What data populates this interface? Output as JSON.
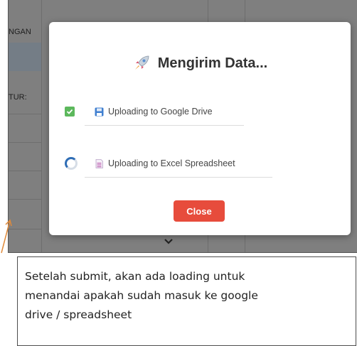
{
  "background": {
    "label_top": "NGAN",
    "label_mid": "TUR:"
  },
  "modal": {
    "title_icon": "rocket-icon",
    "title": "Mengirim Data...",
    "items": [
      {
        "status": "done",
        "status_icon": "check-icon",
        "file_icon": "disk-icon",
        "label": "Uploading to Google Drive"
      },
      {
        "status": "loading",
        "status_icon": "spinner-icon",
        "file_icon": "spreadsheet-icon",
        "label": "Uploading to Excel Spreadsheet"
      }
    ],
    "close_label": "Close"
  },
  "caption": {
    "text": "Setelah submit, akan ada loading untuk menandai apakah sudah masuk ke google drive / spreadsheet"
  },
  "colors": {
    "overlay": "#7f7f7f",
    "success": "#5cb85c",
    "spinner": "#2f6db5",
    "close_button": "#e74c3c",
    "arrow": "#e08a3a"
  }
}
